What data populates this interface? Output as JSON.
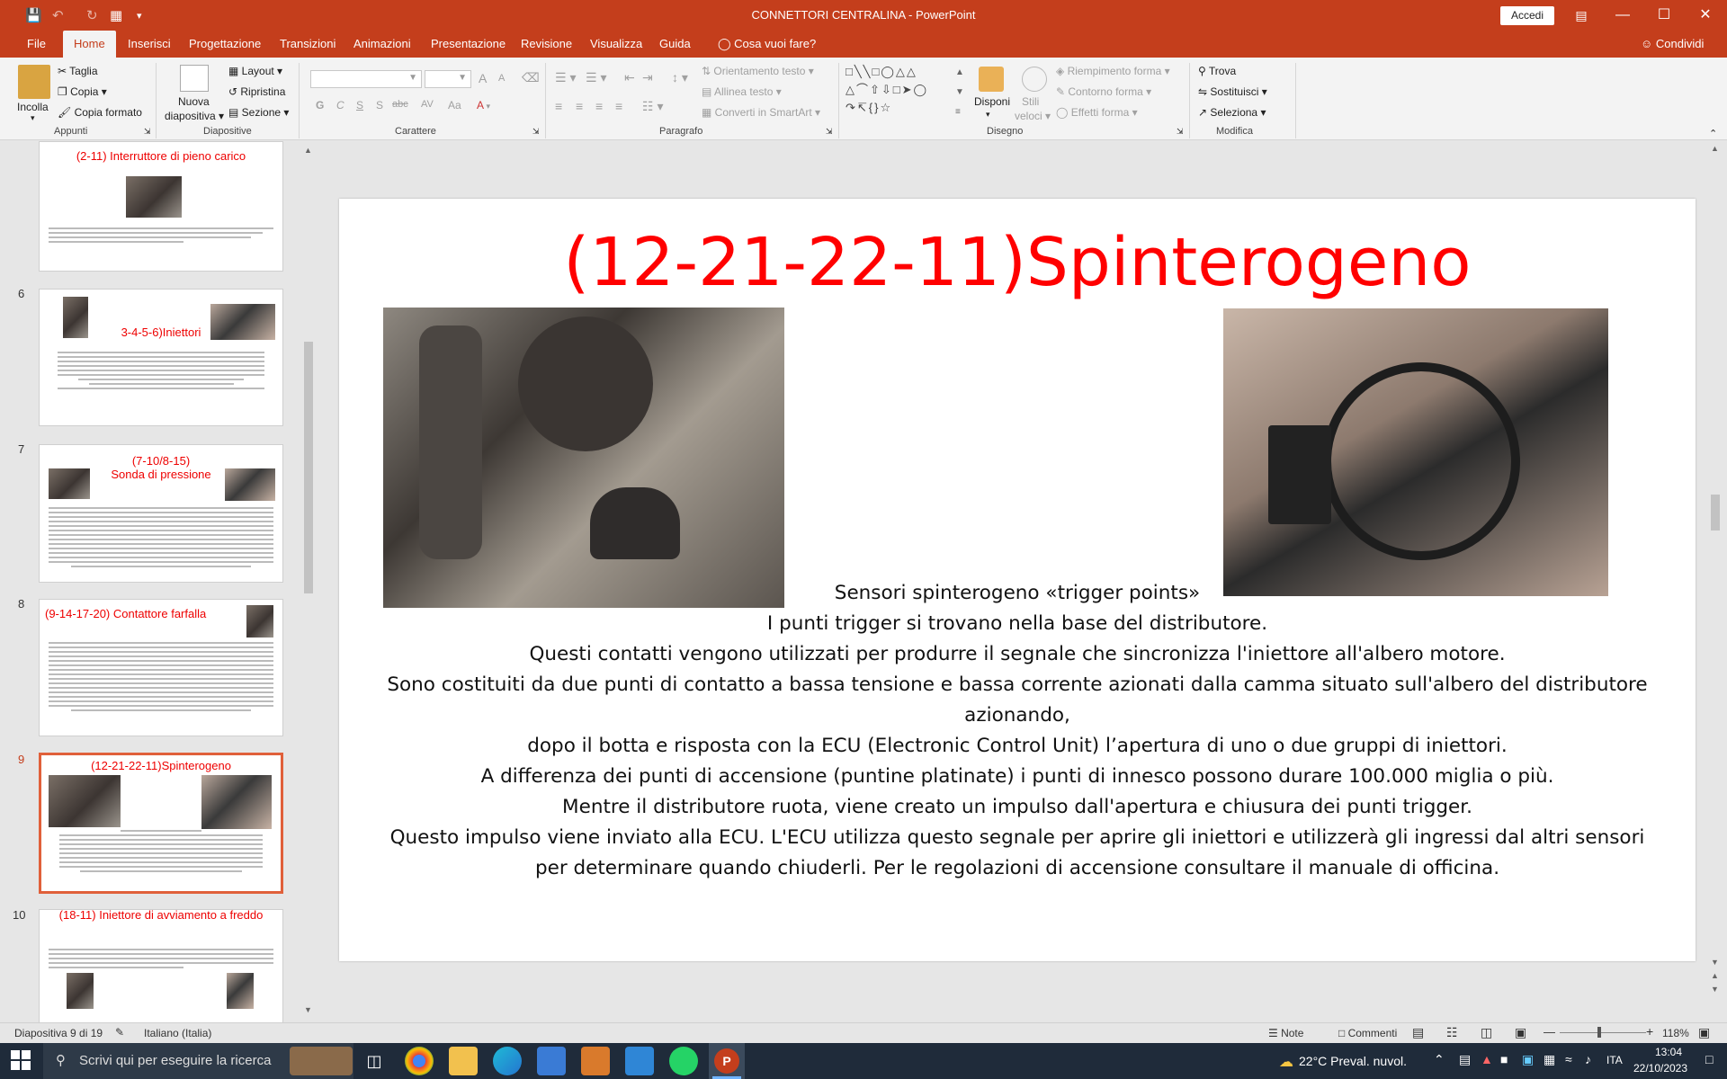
{
  "window": {
    "title": "CONNETTORI CENTRALINA  -  PowerPoint",
    "signin": "Accedi",
    "share": "Condividi"
  },
  "tabs": [
    "File",
    "Home",
    "Inserisci",
    "Progettazione",
    "Transizioni",
    "Animazioni",
    "Presentazione",
    "Revisione",
    "Visualizza",
    "Guida"
  ],
  "tellme": "Cosa vuoi fare?",
  "ribbon": {
    "clipboard": {
      "paste": "Incolla",
      "cut": "Taglia",
      "copy": "Copia",
      "format_painter": "Copia formato",
      "label": "Appunti"
    },
    "slides": {
      "new_slide_l1": "Nuova",
      "new_slide_l2": "diapositiva",
      "layout": "Layout",
      "reset": "Ripristina",
      "section": "Sezione",
      "label": "Diapositive"
    },
    "font": {
      "bold": "G",
      "italic": "C",
      "underline": "S",
      "shadow": "S",
      "strike": "abc",
      "spacing": "AV",
      "case": "Aa",
      "color": "A",
      "grow": "A",
      "shrink": "A",
      "label": "Carattere"
    },
    "paragraph": {
      "text_dir": "Orientamento testo",
      "align_text": "Allinea testo",
      "smartart": "Converti in SmartArt",
      "label": "Paragrafo"
    },
    "drawing": {
      "arrange": "Disponi",
      "styles_l1": "Stili",
      "styles_l2": "veloci",
      "fill": "Riempimento forma",
      "outline": "Contorno forma",
      "effects": "Effetti forma",
      "label": "Disegno"
    },
    "editing": {
      "find": "Trova",
      "replace": "Sostituisci",
      "select": "Seleziona",
      "label": "Modifica"
    }
  },
  "thumbnails": [
    {
      "num": "",
      "title": "(2-11) Interruttore di pieno carico"
    },
    {
      "num": "6",
      "title": "3-4-5-6)Iniettori"
    },
    {
      "num": "7",
      "title_l1": "(7-10/8-15)",
      "title_l2": "Sonda di pressione"
    },
    {
      "num": "8",
      "title_a": "(9-14-17-20) Contattore",
      "title_b": "farfalla"
    },
    {
      "num": "9",
      "title": "(12-21-22-11)Spinterogeno"
    },
    {
      "num": "10",
      "title": "(18-11) Iniettore di avviamento a freddo"
    }
  ],
  "slide": {
    "title": "(12-21-22-11)Spinterogeno",
    "lines": [
      "Sensori spinterogeno «trigger points»",
      "I punti trigger si trovano nella base del distributore.",
      "Questi contatti vengono utilizzati per produrre il segnale che sincronizza l'iniettore all'albero motore.",
      "Sono costituiti da due punti di contatto a bassa tensione e bassa corrente azionati dalla camma situato sull'albero del distributore azionando,",
      "dopo il botta e risposta con la ECU (Electronic Control Unit) l’apertura di uno o due gruppi di iniettori.",
      "A differenza dei punti di accensione (puntine platinate)  i punti di innesco possono durare 100.000 miglia o più.",
      "Mentre il distributore ruota, viene creato un impulso dall'apertura e chiusura dei punti trigger.",
      "Questo impulso viene inviato alla ECU. L'ECU utilizza questo segnale per aprire gli iniettori e utilizzerà gli ingressi dal altri sensori per determinare quando chiuderli. Per le regolazioni di accensione consultare il manuale di officina."
    ]
  },
  "status": {
    "slide_pos": "Diapositiva 9 di 19",
    "language": "Italiano (Italia)",
    "notes": "Note",
    "comments": "Commenti",
    "zoom": "118%"
  },
  "taskbar": {
    "search": "Scrivi qui per eseguire la ricerca",
    "weather": "22°C  Preval. nuvol.",
    "lang": "ITA",
    "time": "13:04",
    "date": "22/10/2023"
  },
  "colors": {
    "accent": "#c43e1c",
    "title_red": "#ff0000"
  }
}
